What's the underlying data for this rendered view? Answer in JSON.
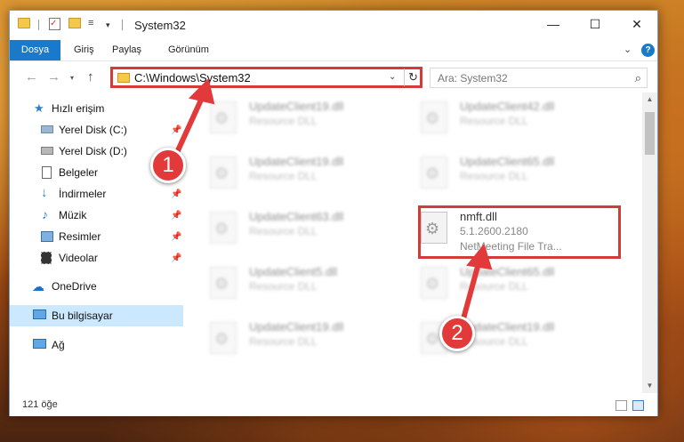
{
  "window": {
    "title": "System32",
    "title_separator": "|",
    "controls": {
      "minimize": "—",
      "maximize": "☐",
      "close": "✕"
    }
  },
  "ribbon": {
    "tabs": [
      "Dosya",
      "Giriş",
      "Paylaş",
      "Görünüm"
    ],
    "active_tab": "Dosya",
    "active_color": "#1979ca",
    "expand_glyph": "⌄",
    "help_glyph": "?"
  },
  "navigation": {
    "back_glyph": "←",
    "forward_glyph": "→",
    "recent_glyph": "▾",
    "up_glyph": "↑",
    "address": "C:\\Windows\\System32",
    "address_dropdown_glyph": "⌄",
    "refresh_glyph": "↻",
    "search_placeholder": "Ara: System32",
    "search_glyph": "⌕"
  },
  "sidebar": {
    "items": [
      {
        "label": "Hızlı erişim",
        "icon": "star-icon",
        "pinned": false
      },
      {
        "label": "Yerel Disk (C:)",
        "icon": "drive-icon",
        "pinned": true
      },
      {
        "label": "Yerel Disk (D:)",
        "icon": "drive-icon",
        "pinned": false
      },
      {
        "label": "Belgeler",
        "icon": "document-icon",
        "pinned": true
      },
      {
        "label": "İndirmeler",
        "icon": "download-icon",
        "pinned": true
      },
      {
        "label": "Müzik",
        "icon": "music-icon",
        "pinned": true
      },
      {
        "label": "Resimler",
        "icon": "pictures-icon",
        "pinned": true
      },
      {
        "label": "Videolar",
        "icon": "video-icon",
        "pinned": true
      },
      {
        "label": "OneDrive",
        "icon": "cloud-icon",
        "pinned": false
      },
      {
        "label": "Bu bilgisayar",
        "icon": "computer-icon",
        "pinned": false,
        "selected": true
      },
      {
        "label": "Ağ",
        "icon": "network-icon",
        "pinned": false
      }
    ],
    "pin_glyph": "📌"
  },
  "files": {
    "left_column": [
      {
        "name": "UpdateClient19.dll",
        "desc": "Resource DLL"
      },
      {
        "name": "UpdateClient19.dll",
        "desc": "Resource DLL"
      },
      {
        "name": "UpdateClient63.dll",
        "desc": "Resource DLL"
      },
      {
        "name": "UpdateClient5.dll",
        "desc": "Resource DLL"
      },
      {
        "name": "UpdateClient19.dll",
        "desc": "Resource DLL"
      }
    ],
    "right_column": [
      {
        "name": "UpdateClient42.dll",
        "desc": "Resource DLL"
      },
      {
        "name": "UpdateClient65.dll",
        "desc": "Resource DLL"
      },
      {
        "name": "nmft.dll",
        "version": "5.1.2600.2180",
        "desc": "NetMeeting File Tra...",
        "highlighted": true
      },
      {
        "name": "UpdateClient65.dll",
        "desc": "Resource DLL"
      },
      {
        "name": "UpdateClient19.dll",
        "desc": "Resource DLL"
      }
    ]
  },
  "statusbar": {
    "item_count": "121 öğe"
  },
  "callouts": {
    "color": "#e23a3a",
    "badge1": "1",
    "badge2": "2"
  }
}
